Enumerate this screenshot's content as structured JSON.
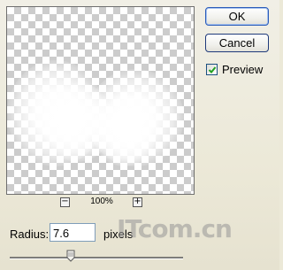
{
  "buttons": {
    "ok_label": "OK",
    "cancel_label": "Cancel"
  },
  "preview": {
    "checkbox_label": "Preview",
    "checked": true
  },
  "zoom": {
    "minus_symbol": "−",
    "level": "100%",
    "plus_symbol": "+"
  },
  "radius": {
    "label": "Radius:",
    "value": "7.6",
    "unit": "pixels",
    "slider_fraction": 0.35
  },
  "watermark": {
    "text": "ITcom.cn"
  },
  "icons": {
    "checkbox_mark": "checkmark-icon",
    "slider_thumb": "slider-thumb-icon"
  },
  "colors": {
    "dialog_bg": "#ece9d8",
    "checker_dark": "#cccccc",
    "checker_light": "#ffffff",
    "ok_border": "#2b5cb9"
  }
}
